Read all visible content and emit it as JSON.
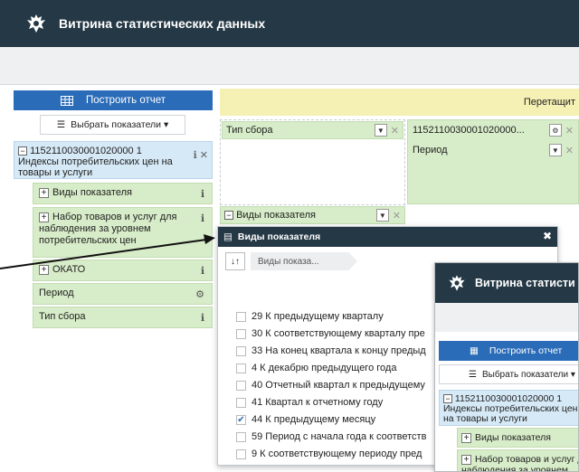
{
  "app": {
    "title": "Витрина статистических данных"
  },
  "left_panel": {
    "build_report": "Построить отчет",
    "select_indicators": "Выбрать показатели ▾",
    "indicator": {
      "code": "1152110030001020000 1",
      "name": "Индексы потребительских цен на товары и услуги"
    },
    "dimensions": [
      {
        "label": "Виды показателя",
        "icon": "info-icon"
      },
      {
        "label": "Набор товаров и услуг для наблюдения за уровнем потребительских цен",
        "icon": "info-icon"
      },
      {
        "label": "ОКАТО",
        "icon": "info-icon"
      },
      {
        "label": "Период",
        "icon": "gear-icon"
      },
      {
        "label": "Тип сбора",
        "icon": "info-icon"
      }
    ]
  },
  "pivot": {
    "drop_hint": "Перетащит",
    "col_field": "Тип сбора",
    "right_code": "1152110030001020000...",
    "right_field": "Период",
    "row_field": "Виды показателя"
  },
  "popup": {
    "title": "Виды показателя",
    "breadcrumb": "Виды показа...",
    "options": [
      {
        "label": "29 К предыдущему кварталу",
        "checked": false
      },
      {
        "label": "30 К соответствующему кварталу пре",
        "checked": false
      },
      {
        "label": "33 На конец квартала к концу предыд",
        "checked": false
      },
      {
        "label": "4 К декабрю предыдущего года",
        "checked": false
      },
      {
        "label": "40 Отчетный квартал к предыдущему",
        "checked": false
      },
      {
        "label": "41 Квартал к отчетному году",
        "checked": false
      },
      {
        "label": "44 К предыдущему месяцу",
        "checked": true
      },
      {
        "label": "59 Период с начала года к соответств",
        "checked": false
      },
      {
        "label": "9 К соответствующему периоду пред",
        "checked": false
      }
    ]
  },
  "thumb": {
    "title": "Витрина статисти",
    "build_report": "Построить отчет",
    "select_indicators": "Выбрать показатели ▾",
    "code": "1152110030001020000 1",
    "name": "Индексы потребительских цен на товары и услуги",
    "dim1": "Виды показателя",
    "dim2": "Набор товаров и услуг д наблюдения за уровнем"
  },
  "colors": {
    "header": "#243845",
    "accent": "#2b6cb8",
    "green": "#d7ecc8",
    "blue_light": "#d6e9f6",
    "yellow": "#f5f0b4"
  }
}
